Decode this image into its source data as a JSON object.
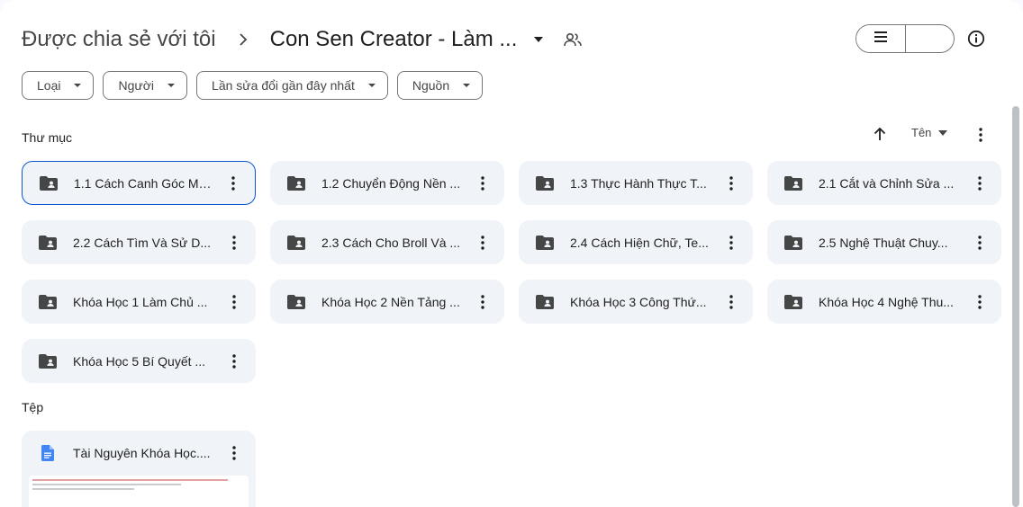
{
  "breadcrumb": {
    "root": "Được chia sẻ với tôi",
    "current": "Con Sen Creator - Làm ..."
  },
  "filters": [
    {
      "label": "Loại"
    },
    {
      "label": "Người"
    },
    {
      "label": "Lần sửa đổi gần đây nhất"
    },
    {
      "label": "Nguồn"
    }
  ],
  "folders_section": {
    "title": "Thư mục",
    "sort_label": "Tên"
  },
  "folders": [
    {
      "name": "1.1 Cách Canh Góc Má..."
    },
    {
      "name": "1.2 Chuyển Động Nền ..."
    },
    {
      "name": "1.3 Thực Hành Thực T..."
    },
    {
      "name": "2.1 Cắt và Chỉnh Sửa ..."
    },
    {
      "name": "2.2 Cách Tìm Và Sử D..."
    },
    {
      "name": "2.3 Cách Cho Broll Và ..."
    },
    {
      "name": "2.4 Cách Hiện Chữ, Te..."
    },
    {
      "name": "2.5 Nghệ Thuật Chuy..."
    },
    {
      "name": "Khóa Học 1 Làm Chủ ..."
    },
    {
      "name": "Khóa Học 2 Nền Tảng ..."
    },
    {
      "name": "Khóa Học 3 Công Thứ..."
    },
    {
      "name": "Khóa Học 4 Nghệ Thu..."
    },
    {
      "name": "Khóa Học 5 Bí Quyết ..."
    }
  ],
  "files_section": {
    "title": "Tệp"
  },
  "files": [
    {
      "name": "Tài Nguyên Khóa Học...."
    }
  ],
  "icons": {
    "breadcrumb_separator": "chevron-right-icon",
    "dropdown": "caret-down-icon",
    "shared": "people-icon",
    "list_view": "list-icon",
    "grid_view": "grid-icon",
    "check": "check-icon",
    "info": "info-icon",
    "folder": "shared-folder-icon",
    "file": "google-docs-icon"
  },
  "colors": {
    "selected_view": "#c2e7ff",
    "card_bg": "#f0f4f9",
    "selected_border": "#0b57d0",
    "doc_blue": "#4285f4"
  }
}
